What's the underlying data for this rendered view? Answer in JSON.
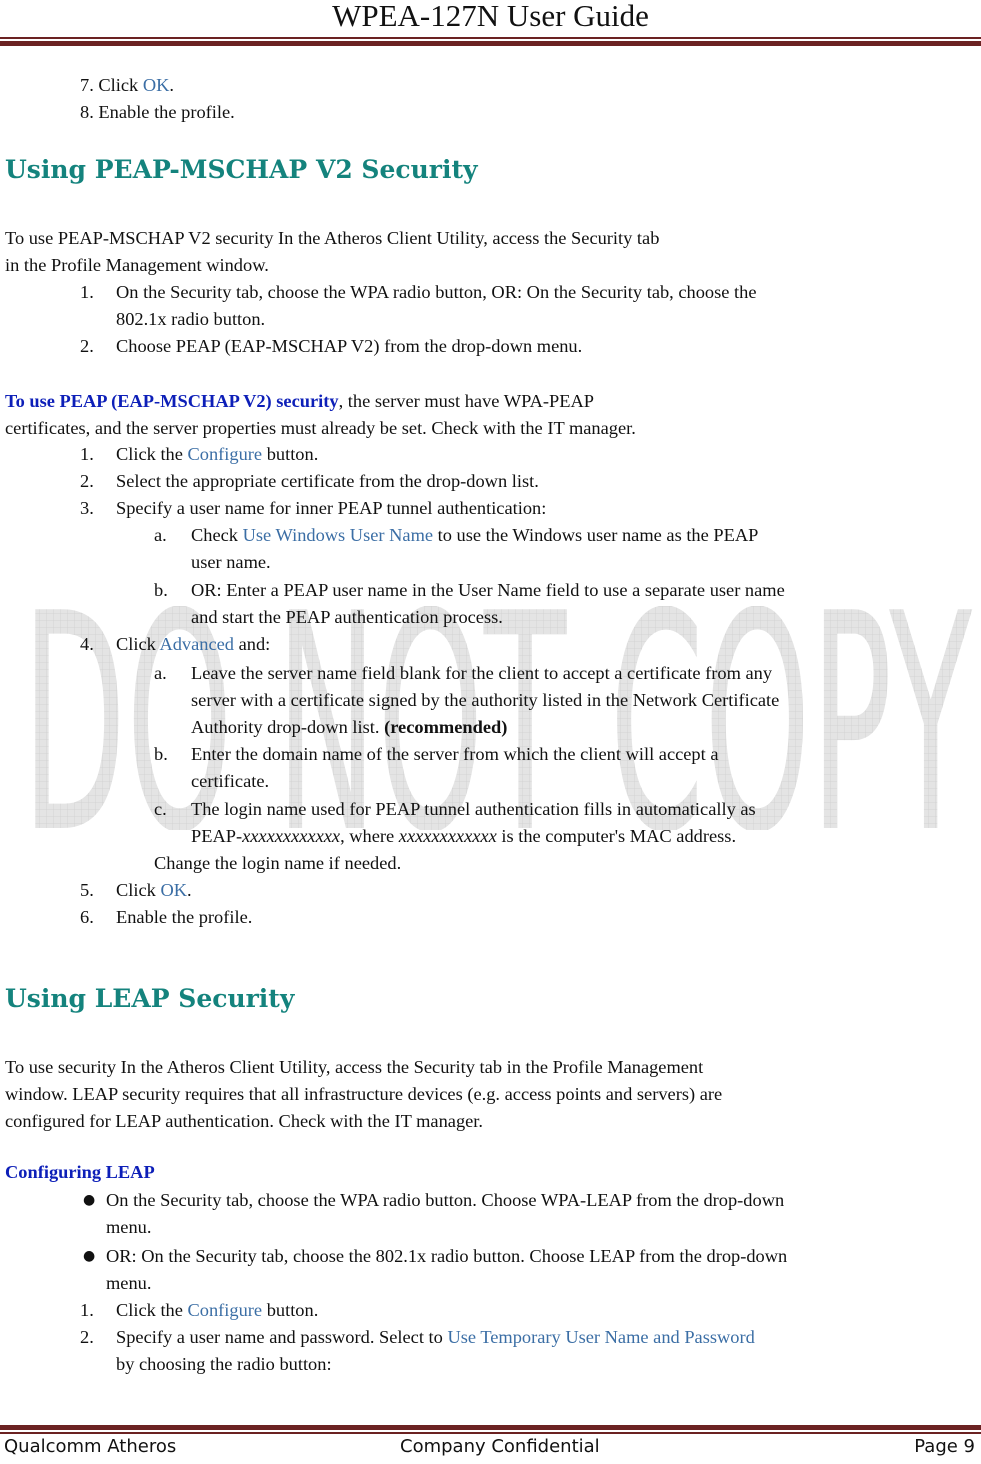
{
  "header": {
    "title": "WPEA-127N User Guide"
  },
  "intro_steps": [
    {
      "num": "7.",
      "pre": "Click ",
      "link": "OK",
      "post": "."
    },
    {
      "num": "8.",
      "text": "Enable the profile."
    }
  ],
  "peap_section": {
    "heading": "Using PEAP-MSCHAP V2 Security",
    "intro_line1": "To use PEAP-MSCHAP V2 security In the Atheros Client Utility, access the Security tab",
    "intro_line2": "in the Profile Management window.",
    "steps": [
      {
        "num": "1.",
        "line1": "On the Security tab, choose the WPA radio button, OR: On the Security tab, choose the",
        "line2": "802.1x radio button."
      },
      {
        "num": "2.",
        "line1": "Choose PEAP (EAP-MSCHAP V2) from the drop-down menu."
      }
    ],
    "sub_lead": "To use PEAP (EAP-MSCHAP V2) security",
    "sub_rest": ", the server must have WPA-PEAP",
    "sub_line2": "certificates, and the server properties must already be set. Check with the IT manager.",
    "sub_steps": {
      "s1": {
        "num": "1.",
        "pre": "Click the ",
        "link": "Configure",
        "post": " button."
      },
      "s2": {
        "num": "2.",
        "text": "Select the appropriate certificate from the drop-down list."
      },
      "s3": {
        "num": "3.",
        "text": "Specify a user name for inner PEAP tunnel authentication:"
      },
      "s3a": {
        "num": "a.",
        "pre": "Check ",
        "link": "Use Windows User Name",
        "post": " to use the Windows user name as the PEAP",
        "line2": "user name."
      },
      "s3b": {
        "num": "b.",
        "line1": "OR: Enter a PEAP user name in the User Name field to use a separate user name",
        "line2": "and start the PEAP authentication process."
      },
      "s4": {
        "num": "4.",
        "pre": "Click ",
        "link": "Advanced",
        "post": " and:"
      },
      "s4a": {
        "num": "a.",
        "line1": "Leave the server name field blank for the client to accept a certificate from any",
        "line2": "server with a certificate signed by the authority listed in the Network Certificate",
        "line3": "Authority drop-down list. ",
        "line3_bold": "(recommended)"
      },
      "s4b": {
        "num": "b.",
        "line1": "Enter the domain name of the server from which the client will accept a",
        "line2": "certificate."
      },
      "s4c": {
        "num": "c.",
        "line1": "The login name used for PEAP tunnel authentication fills in automatically as",
        "l2_pre": "PEAP-",
        "l2_ital1": "xxxxxxxxxxxx",
        "l2_mid": ", where ",
        "l2_ital2": "xxxxxxxxxxxx",
        "l2_post": " is the computer's MAC address."
      },
      "s4c_tail": "Change the login name if needed.",
      "s5": {
        "num": "5.",
        "pre": "Click ",
        "link": "OK",
        "post": "."
      },
      "s6": {
        "num": "6.",
        "text": "Enable the profile."
      }
    }
  },
  "leap_section": {
    "heading": "Using LEAP Security",
    "para_line1": "To use security In the Atheros Client Utility, access the Security tab in the Profile Management",
    "para_line2": "window. LEAP security requires that all infrastructure devices (e.g. access points and servers) are",
    "para_line3": "configured for LEAP authentication. Check with the IT manager.",
    "subheading": "Configuring LEAP",
    "bullets": [
      {
        "line1": "On the Security tab, choose the WPA radio button. Choose WPA-LEAP from the drop-down",
        "line2": "menu."
      },
      {
        "line1": "OR: On the Security tab, choose the 802.1x radio button. Choose LEAP from the drop-down",
        "line2": "menu."
      }
    ],
    "steps": {
      "s1": {
        "num": "1.",
        "pre": "Click the ",
        "link": "Configure",
        "post": " button."
      },
      "s2": {
        "num": "2.",
        "pre": "Specify a user name and password. Select to ",
        "link": "Use Temporary User Name and Password",
        "line2": "by choosing the radio button:"
      }
    }
  },
  "watermark": {
    "text": "DO NOT COPY"
  },
  "footer": {
    "left": "Qualcomm Atheros",
    "center": "Company Confidential",
    "right": "Page 9"
  },
  "colors": {
    "heading": "#14837d",
    "subheading": "#0d1fb8",
    "link": "#3b6ea5",
    "rule": "#6b2222"
  }
}
